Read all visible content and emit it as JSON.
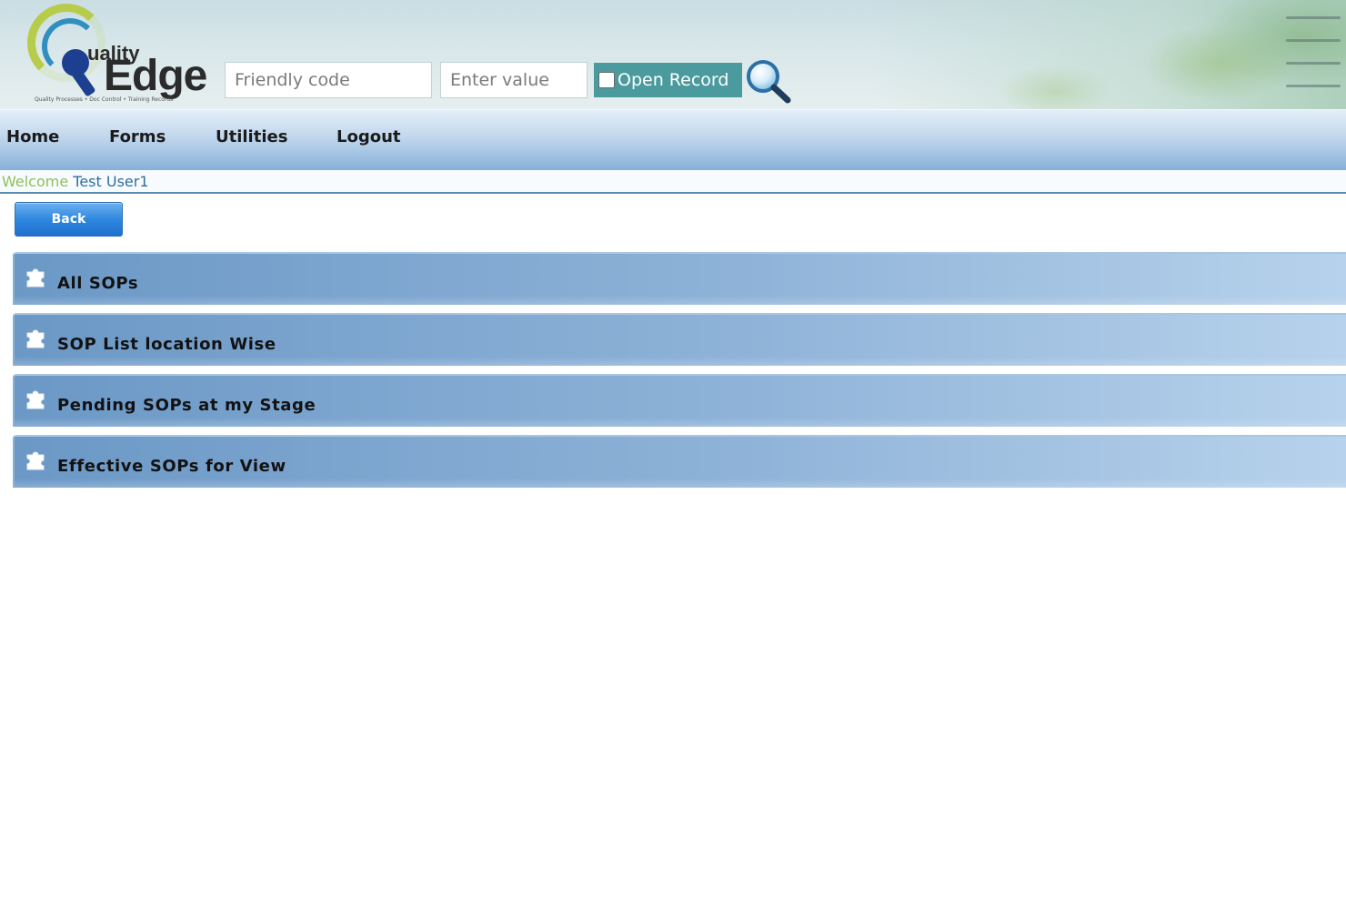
{
  "header": {
    "logo": {
      "text_uality": "uality",
      "text_edge": "Edge",
      "tagline": "Quality Processes • Doc Control • Training Records"
    },
    "friendly_code_placeholder": "Friendly code",
    "enter_value_placeholder": "Enter value",
    "open_record_label": "Open Record",
    "open_record_checked": false,
    "search_icon": "magnifier-icon"
  },
  "nav": {
    "items": [
      {
        "label": "Home"
      },
      {
        "label": "Forms"
      },
      {
        "label": "Utilities"
      },
      {
        "label": "Logout"
      }
    ]
  },
  "welcome": {
    "prefix": "Welcome",
    "user": "Test User1"
  },
  "back_button": {
    "label": "Back"
  },
  "sop_panels": [
    {
      "label": "All SOPs",
      "icon": "puzzle-icon"
    },
    {
      "label": "SOP List location Wise",
      "icon": "puzzle-icon"
    },
    {
      "label": "Pending SOPs at my Stage",
      "icon": "puzzle-icon"
    },
    {
      "label": "Effective SOPs for View",
      "icon": "puzzle-icon"
    }
  ],
  "colors": {
    "nav_gradient_bottom": "#86b0d8",
    "panel_gradient_left": "#6b98c6",
    "panel_gradient_right": "#b7d2ec",
    "open_record_bg": "#4a9a9e",
    "back_button_blue": "#2f88e0",
    "welcome_green": "#8fbf5a",
    "welcome_blue": "#2f6e9e"
  }
}
